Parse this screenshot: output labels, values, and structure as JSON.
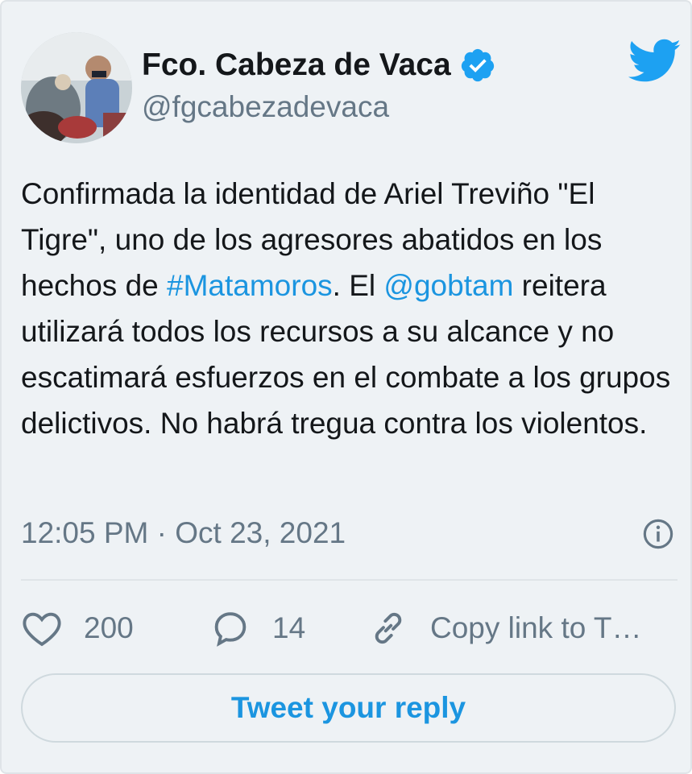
{
  "user": {
    "display_name": "Fco. Cabeza de Vaca",
    "handle": "@fgcabezadevaca",
    "verified_icon": "verified-badge-icon",
    "avatar_icon": "profile-photo"
  },
  "brand": {
    "icon": "twitter-bird-icon",
    "color": "#1da1f2"
  },
  "tweet": {
    "segments": [
      {
        "type": "text",
        "value": "Confirmada la identidad de Ariel Treviño \"El Tigre\", uno de los agresores abatidos en los hechos de "
      },
      {
        "type": "hashtag",
        "value": "#Matamoros"
      },
      {
        "type": "text",
        "value": ". El "
      },
      {
        "type": "mention",
        "value": "@gobtam"
      },
      {
        "type": "text",
        "value": " reitera utilizará todos los recursos a su alcance y no escatimará esfuerzos en el combate a los grupos delictivos. No habrá tregua contra los violentos."
      }
    ]
  },
  "meta": {
    "timestamp": "12:05 PM · Oct 23, 2021",
    "info_icon": "info-icon"
  },
  "actions": {
    "like_count": "200",
    "reply_count": "14",
    "copy_link_label": "Copy link to T…"
  },
  "reply_button": {
    "label": "Tweet your reply"
  },
  "colors": {
    "background": "#eef2f5",
    "text": "#14171a",
    "secondary": "#657786",
    "link": "#1b95e0"
  }
}
